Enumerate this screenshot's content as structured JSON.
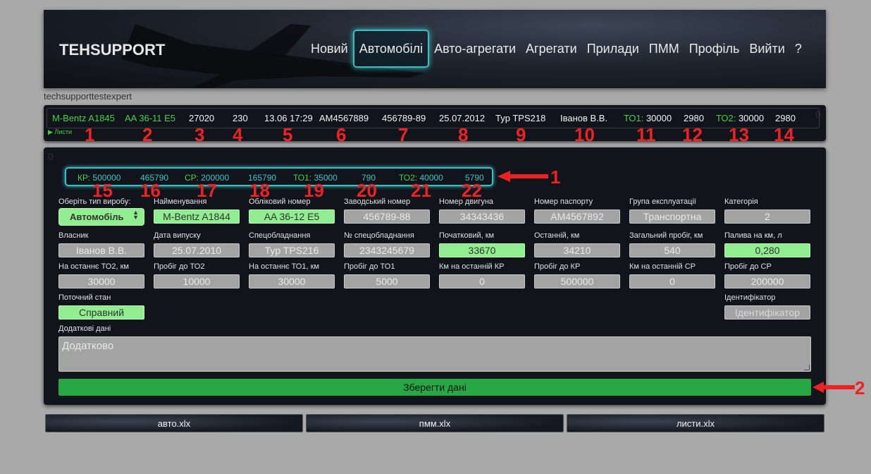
{
  "header": {
    "brand": "TEHSUPPORT",
    "nav": [
      "Новий",
      "Автомобілі",
      "Авто-агрегати",
      "Агрегати",
      "Прилади",
      "ПММ",
      "Профіль",
      "Вийти",
      "?"
    ],
    "active_nav": "Автомобілі"
  },
  "username": "techsupporttestexpert",
  "infobar": {
    "name": "M-Bentz A1845",
    "plate": "AA 36-11 E5",
    "v3": "27020",
    "v4": "230",
    "datetime": "13.06 17:29",
    "passport": "AM4567889",
    "serial": "456789-89",
    "date": "25.07.2012",
    "type": "Typ TPS218",
    "owner": "Іванов В.В.",
    "to1_label": "ТО1:",
    "to1_value": "30000",
    "v12": "2980",
    "to2_label": "ТО2:",
    "to2_value": "30000",
    "v14": "2980",
    "lists_link": "Листи",
    "zero": "0"
  },
  "panel_zero": "0",
  "to_box": {
    "kr_label": "КР:",
    "kr_value": "500000",
    "v16": "465790",
    "sr_label": "СР:",
    "sr_value": "200000",
    "v18": "165790",
    "to1_label": "ТО1:",
    "to1_value": "35000",
    "v20": "790",
    "to2_label": "ТО2:",
    "to2_value": "40000",
    "v22": "5790"
  },
  "annotations": {
    "infobar": [
      "1",
      "2",
      "3",
      "4",
      "5",
      "6",
      "7",
      "8",
      "9",
      "10",
      "11",
      "12",
      "13",
      "14"
    ],
    "tobox": [
      "15",
      "16",
      "17",
      "18",
      "19",
      "20",
      "21",
      "22"
    ],
    "box_arrow": "1",
    "save_arrow": "2"
  },
  "form": {
    "type_label": "Оберіть тип виробу:",
    "type_value": "Автомобіль",
    "name_label": "Найменування",
    "name_value": "M-Bentz A1844",
    "reg_label": "Обліковий номер",
    "reg_value": "AA 36-12 E5",
    "factory_label": "Заводський номер",
    "factory_value": "456789-88",
    "engine_label": "Номер двигуна",
    "engine_value": "34343436",
    "passport_label": "Номер паспорту",
    "passport_value": "AM4567892",
    "group_label": "Група експлуатації",
    "group_value": "Транспортна",
    "category_label": "Категорія",
    "category_value": "2",
    "owner_label": "Власник",
    "owner_value": "Іванов В.В.",
    "release_label": "Дата випуску",
    "release_value": "25.07.2010",
    "equip_label": "Спецобладнання",
    "equip_value": "Typ TPS216",
    "equip_no_label": "№ спецобладнання",
    "equip_no_value": "2343245679",
    "start_km_label": "Початковий, км",
    "start_km_value": "33670",
    "last_km_label": "Останній, км",
    "last_km_value": "34210",
    "total_label": "Загальний пробіг, км",
    "total_value": "540",
    "fuel_label": "Палива на км, л",
    "fuel_value": "0,280",
    "last_to2_label": "На останнє ТО2, км",
    "last_to2_value": "30000",
    "to2_left_label": "Пробіг до ТО2",
    "to2_left_value": "10000",
    "last_to1_label": "На останнє ТО1, км",
    "last_to1_value": "30000",
    "to1_left_label": "Пробіг до ТО1",
    "to1_left_value": "5000",
    "km_kr_label": "Км на останній КР",
    "km_kr_value": "0",
    "kr_left_label": "Пробіг до КР",
    "kr_left_value": "500000",
    "km_sr_label": "Км на останній СР",
    "km_sr_value": "0",
    "sr_left_label": "Пробіг до СР",
    "sr_left_value": "200000",
    "state_label": "Поточний стан",
    "state_value": "Справний",
    "ident_label": "Ідентифікатор",
    "ident_placeholder": "Ідентифікатор",
    "extra_label": "Додаткові дані",
    "extra_placeholder": "Додатково",
    "save_button": "Зберегти дані"
  },
  "exports": [
    "авто.xlx",
    "пмм.xlx",
    "листи.xlx"
  ],
  "colors": {
    "accent_cyan": "#3bbec4",
    "green_text": "#48d048",
    "highlight_field": "#90ee90",
    "save_button": "#28a745",
    "annotation_red": "#ee2222"
  }
}
